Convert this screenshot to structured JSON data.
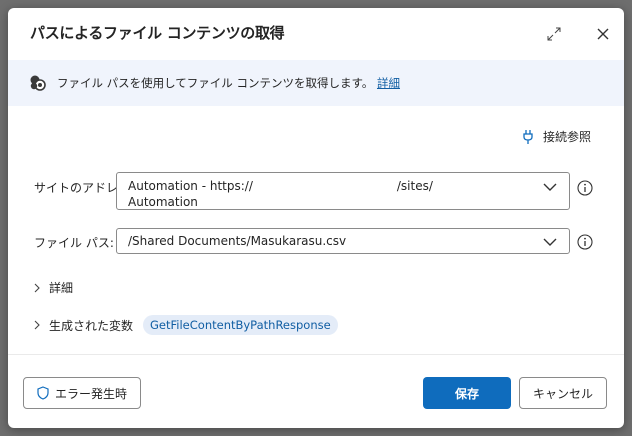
{
  "dialog": {
    "title": "パスによるファイル コンテンツの取得",
    "expand_icon": "expand-icon",
    "close_icon": "close-icon"
  },
  "banner": {
    "icon": "connector-icon",
    "text": "ファイル パスを使用してファイル コンテンツを取得します。",
    "link": "詳細"
  },
  "connection": {
    "icon": "plug-icon",
    "label": "接続参照"
  },
  "fields": {
    "site": {
      "label": "サイトのアドレス:",
      "value_part1": "Automation - https://",
      "value_part2": "/sites/",
      "value_line2": "Automation"
    },
    "path": {
      "label": "ファイル パス:",
      "value": "/Shared Documents/Masukarasu.csv"
    }
  },
  "sections": {
    "details": "詳細",
    "generated_vars": "生成された変数",
    "variable": "GetFileContentByPathResponse"
  },
  "buttons": {
    "on_error": "エラー発生時",
    "save": "保存",
    "cancel": "キャンセル"
  },
  "colors": {
    "accent": "#0f6cbd",
    "banner_bg": "#f0f4fc",
    "link": "#115ea3",
    "chip_bg": "#e4ecf8"
  }
}
